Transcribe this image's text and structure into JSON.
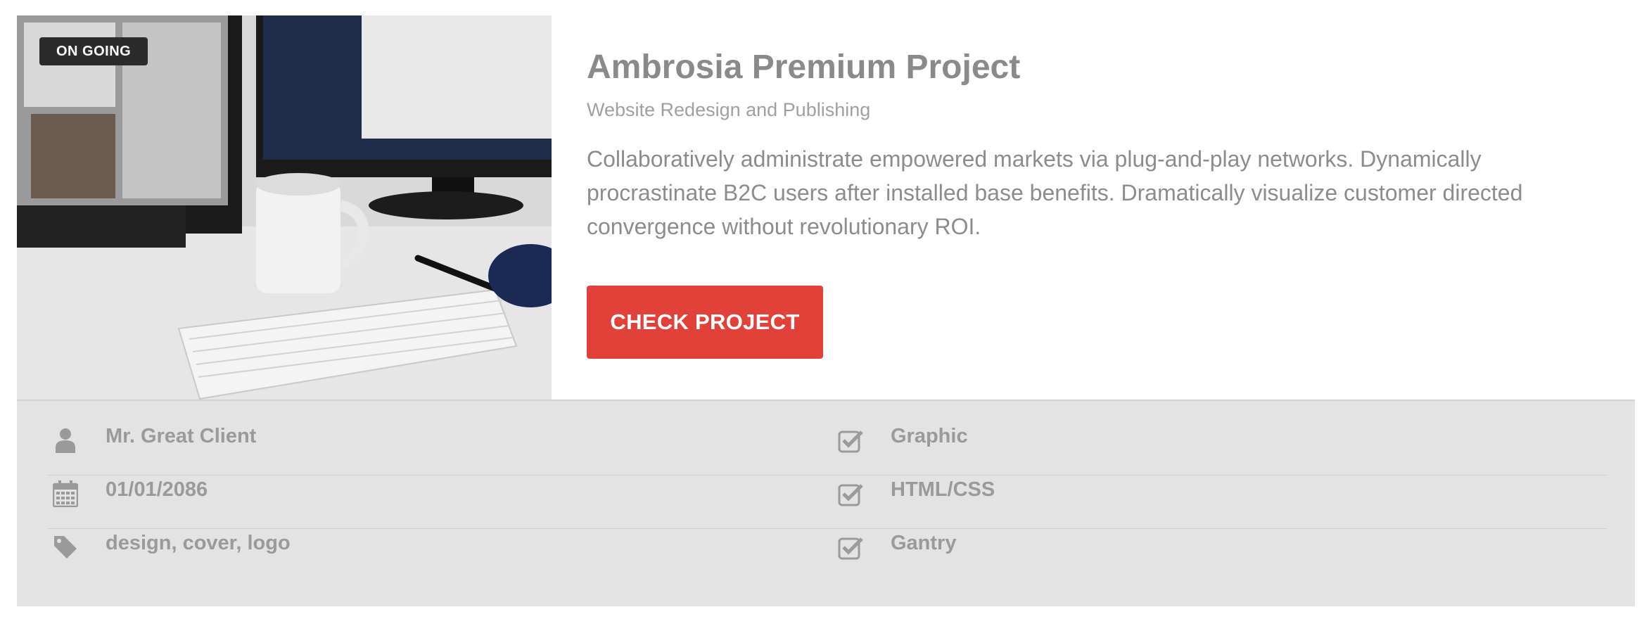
{
  "badge": "ON GOING",
  "project": {
    "title": "Ambrosia Premium Project",
    "subtitle": "Website Redesign and Publishing",
    "description": "Collaboratively administrate empowered markets via plug-and-play networks. Dynamically procrastinate B2C users after installed base benefits. Dramatically visualize customer directed convergence without revolutionary ROI.",
    "cta_label": "CHECK PROJECT"
  },
  "meta": {
    "client": "Mr. Great Client",
    "date": "01/01/2086",
    "tags": "design, cover, logo",
    "skills": [
      "Graphic",
      "HTML/CSS",
      "Gantry"
    ]
  },
  "icons": {
    "client": "user-icon",
    "date": "calendar-icon",
    "tags": "tag-icon",
    "skill": "check-square-icon"
  },
  "colors": {
    "accent": "#e2413a",
    "meta_background": "#e3e3e3",
    "badge_background": "#2b2b2b",
    "text_muted": "#8a8a8a"
  }
}
